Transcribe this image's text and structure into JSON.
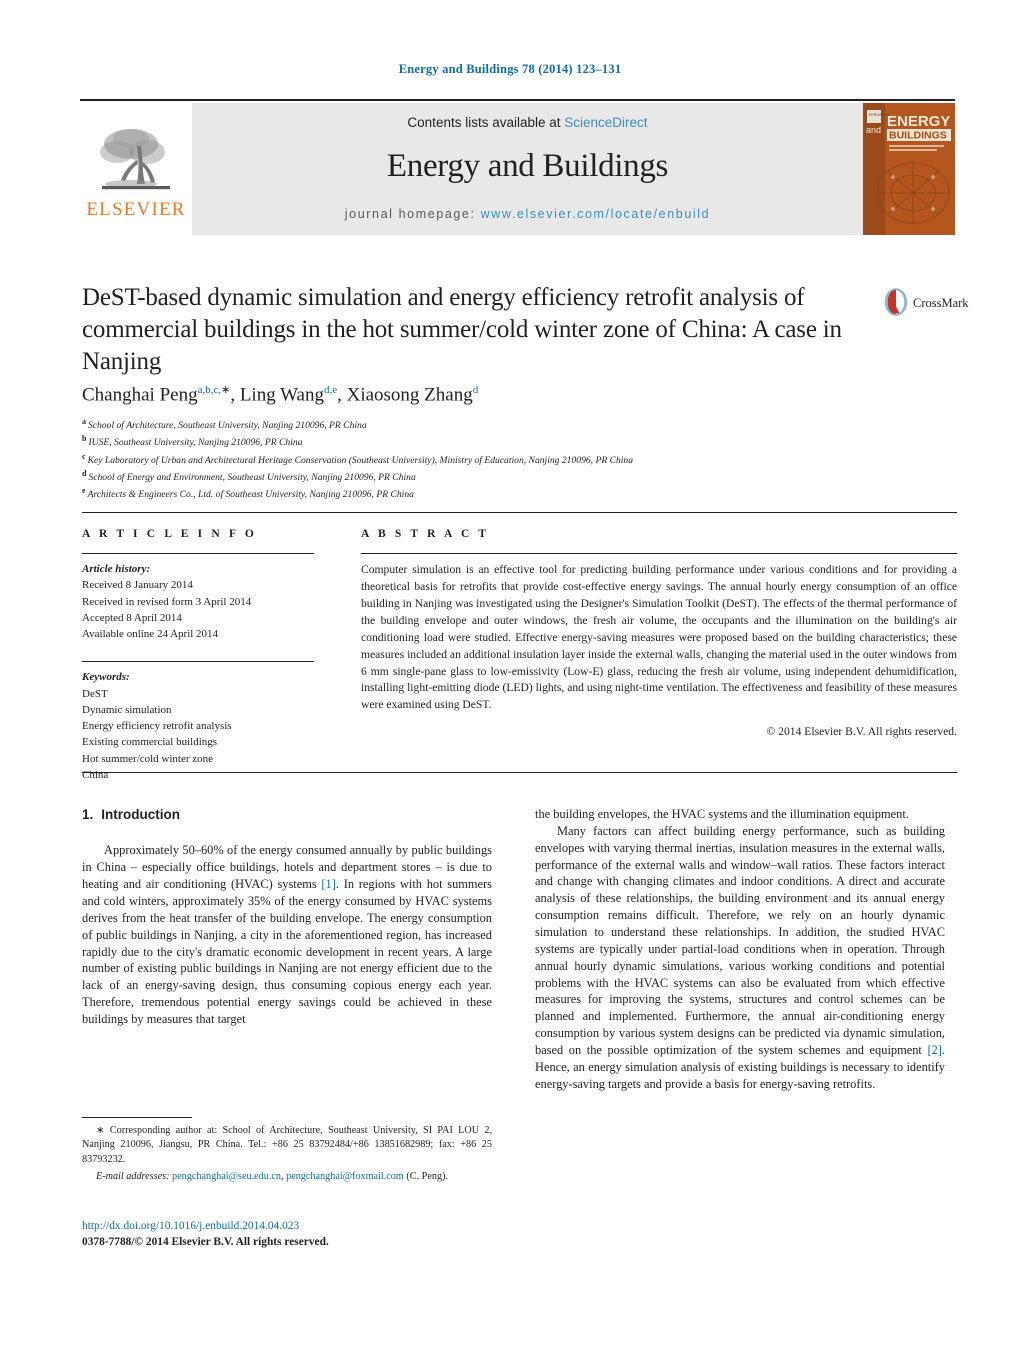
{
  "running_head": "Energy and Buildings 78 (2014) 123–131",
  "masthead": {
    "contents_prefix": "Contents lists available at",
    "sciencedirect": "ScienceDirect",
    "journal_title": "Energy and Buildings",
    "homepage_label": "journal homepage:",
    "homepage_url": "www.elsevier.com/locate/enbuild",
    "publisher_wordmark": "ELSEVIER",
    "cover": {
      "line_and": "and",
      "line_energy": "ENERGY",
      "line_buildings": "BUILDINGS"
    },
    "colors": {
      "elsevier_orange": "#ee7623",
      "link_blue": "#3a8ec4",
      "band_grey": "#e8e8e8",
      "cover_orange": "#b4571f"
    }
  },
  "crossmark": {
    "label": "CrossMark"
  },
  "article": {
    "title": "DeST-based dynamic simulation and energy efficiency retrofit analysis of commercial buildings in the hot summer/cold winter zone of China: A case in Nanjing",
    "authors_html": "Changhai Peng<sup>a,b,c,</sup><sup class=\"star\">∗</sup>, Ling Wang<sup>d,e</sup>, Xiaosong Zhang<sup>d</sup>",
    "affiliations": [
      {
        "mark": "a",
        "text": "School of Architecture, Southeast University, Nanjing 210096, PR China"
      },
      {
        "mark": "b",
        "text": "IUSE, Southeast University, Nanjing 210096, PR China"
      },
      {
        "mark": "c",
        "text": "Key Laboratory of Urban and Architectural Heritage Conservation (Southeast University), Ministry of Education, Nanjing 210096, PR China"
      },
      {
        "mark": "d",
        "text": "School of Energy and Environment, Southeast University, Nanjing 210096, PR China"
      },
      {
        "mark": "e",
        "text": "Architects & Engineers Co., Ltd. of Southeast University, Nanjing 210096, PR China"
      }
    ]
  },
  "article_info": {
    "heading": "A R T I C L E    I N F O",
    "history_label": "Article history:",
    "history": [
      "Received 8 January 2014",
      "Received in revised form 3 April 2014",
      "Accepted 8 April 2014",
      "Available online 24 April 2014"
    ],
    "keywords_label": "Keywords:",
    "keywords": [
      "DeST",
      "Dynamic simulation",
      "Energy efficiency retrofit analysis",
      "Existing commercial buildings",
      "Hot summer/cold winter zone",
      "China"
    ]
  },
  "abstract": {
    "heading": "A B S T R A C T",
    "text": "Computer simulation is an effective tool for predicting building performance under various conditions and for providing a theoretical basis for retrofits that provide cost-effective energy savings. The annual hourly energy consumption of an office building in Nanjing was investigated using the Designer's Simulation Toolkit (DeST). The effects of the thermal performance of the building envelope and outer windows, the fresh air volume, the occupants and the illumination on the building's air conditioning load were studied. Effective energy-saving measures were proposed based on the building characteristics; these measures included an additional insulation layer inside the external walls, changing the material used in the outer windows from 6 mm single-pane glass to low-emissivity (Low-E) glass, reducing the fresh air volume, using independent dehumidification, installing light-emitting diode (LED) lights, and using night-time ventilation. The effectiveness and feasibility of these measures were examined using DeST.",
    "copyright": "© 2014 Elsevier B.V. All rights reserved."
  },
  "body": {
    "section_number": "1.",
    "section_title": "Introduction",
    "left_paragraphs": [
      "Approximately 50–60% of the energy consumed annually by public buildings in China – especially office buildings, hotels and department stores – is due to heating and air conditioning (HVAC) systems [1]. In regions with hot summers and cold winters, approximately 35% of the energy consumed by HVAC systems derives from the heat transfer of the building envelope. The energy consumption of public buildings in Nanjing, a city in the aforementioned region, has increased rapidly due to the city's dramatic economic development in recent years. A large number of existing public buildings in Nanjing are not energy efficient due to the lack of an energy-saving design, thus consuming copious energy each year. Therefore, tremendous potential energy savings could be achieved in these buildings by measures that target"
    ],
    "right_paragraphs": [
      "the building envelopes, the HVAC systems and the illumination equipment.",
      "Many factors can affect building energy performance, such as building envelopes with varying thermal inertias, insulation measures in the external walls, performance of the external walls and window–wall ratios. These factors interact and change with changing climates and indoor conditions. A direct and accurate analysis of these relationships, the building environment and its annual energy consumption remains difficult. Therefore, we rely on an hourly dynamic simulation to understand these relationships. In addition, the studied HVAC systems are typically under partial-load conditions when in operation. Through annual hourly dynamic simulations, various working conditions and potential problems with the HVAC systems can also be evaluated from which effective measures for improving the systems, structures and control schemes can be planned and implemented. Furthermore, the annual air-conditioning energy consumption by various system designs can be predicted via dynamic simulation, based on the possible optimization of the system schemes and equipment [2]. Hence, an energy simulation analysis of existing buildings is necessary to identify energy-saving targets and provide a basis for energy-saving retrofits."
    ],
    "reference_marks": [
      "[1]",
      "[2]"
    ]
  },
  "footnote": {
    "star": "∗",
    "corresponding": "Corresponding author at: School of Architecture, Southeast University, SI PAI LOU 2, Nanjing 210096, Jiangsu, PR China. Tel.: +86 25 83792484/+86 13851682989; fax: +86 25 83793232.",
    "email_label": "E-mail addresses:",
    "emails": [
      "pengchanghai@seu.edu.cn",
      "pengchanghai@foxmail.com"
    ],
    "email_owner": "(C. Peng)."
  },
  "doi": {
    "url": "http://dx.doi.org/10.1016/j.enbuild.2014.04.023",
    "issn_line": "0378-7788/© 2014 Elsevier B.V. All rights reserved."
  }
}
